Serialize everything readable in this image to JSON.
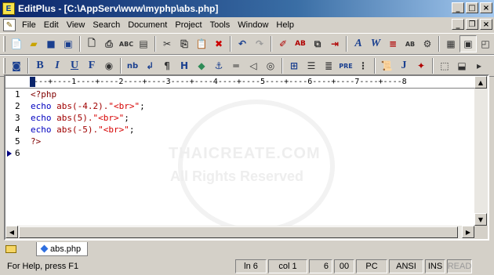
{
  "window": {
    "title": "EditPlus - [C:\\AppServ\\www\\myphp\\abs.php]",
    "app_icon": "editplus-icon"
  },
  "menu": [
    "File",
    "Edit",
    "View",
    "Search",
    "Document",
    "Project",
    "Tools",
    "Window",
    "Help"
  ],
  "toolbar1": [
    "new-file-icon",
    "open-file-icon",
    "save-icon",
    "save-all-icon",
    "print-preview-icon",
    "print-icon",
    "spell-check-icon",
    "template-icon",
    "cut-icon",
    "copy-icon",
    "paste-icon",
    "delete-icon",
    "undo-icon",
    "redo-icon",
    "highlight-icon",
    "replace-icon",
    "duplicate-icon",
    "goto-icon",
    "font-icon",
    "word-wrap-icon",
    "line-number-icon",
    "abc-column-icon",
    "settings-icon",
    "view-icon",
    "screen-icon",
    "browser-icon"
  ],
  "toolbar2": {
    "bold": "B",
    "italic": "I",
    "underline": "U",
    "font": "F",
    "nb": "nb",
    "pre": "PRE",
    "j": "J"
  },
  "ruler": "----+----1----+----2----+----3----+----4----+----5----+----6----+----7----+----8",
  "code": {
    "line_numbers": [
      "1",
      "2",
      "3",
      "4",
      "5",
      "6"
    ],
    "lines": [
      [
        {
          "t": "<?php",
          "c": "tag"
        }
      ],
      [
        {
          "t": "echo ",
          "c": "kw"
        },
        {
          "t": "abs",
          "c": "fn"
        },
        {
          "t": "(-4.2).",
          "c": "fn"
        },
        {
          "t": "\"<br>\"",
          "c": "str"
        },
        {
          "t": ";",
          "c": "pl"
        }
      ],
      [
        {
          "t": "echo ",
          "c": "kw"
        },
        {
          "t": "abs",
          "c": "fn"
        },
        {
          "t": "(5).",
          "c": "fn"
        },
        {
          "t": "\"<br>\"",
          "c": "str"
        },
        {
          "t": ";",
          "c": "pl"
        }
      ],
      [
        {
          "t": "echo ",
          "c": "kw"
        },
        {
          "t": "abs",
          "c": "fn"
        },
        {
          "t": "(-5).",
          "c": "fn"
        },
        {
          "t": "\"<br>\"",
          "c": "str"
        },
        {
          "t": ";",
          "c": "pl"
        }
      ],
      [
        {
          "t": "?>",
          "c": "tag"
        }
      ],
      []
    ]
  },
  "watermark": {
    "line1": "THAICREATE.COM",
    "line2": "All Rights Reserved"
  },
  "tab": {
    "label": "abs.php"
  },
  "status": {
    "message": "For Help, press F1",
    "line": "ln 6",
    "col": "col 1",
    "chars": "6",
    "code": "00",
    "mode": "PC",
    "encoding": "ANSI",
    "ins": "INS",
    "read": "READ"
  }
}
